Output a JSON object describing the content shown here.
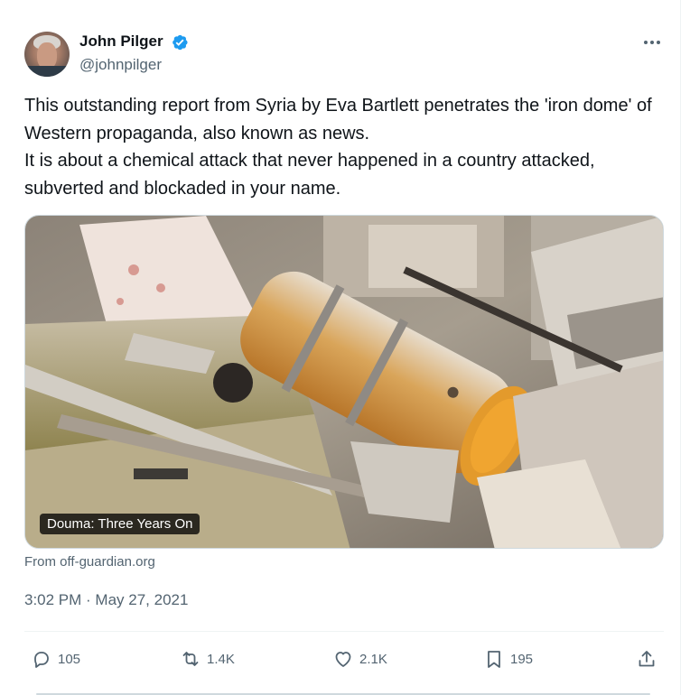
{
  "author": {
    "name": "John Pilger",
    "handle": "@johnpilger",
    "verified_color": "#1d9bf0"
  },
  "tweet": {
    "lines": [
      "This outstanding report from Syria by Eva Bartlett penetrates the 'iron dome' of Western propaganda, also known as news.",
      "It is about a chemical attack that never happened in a country attacked, subverted and blockaded in your name."
    ],
    "timestamp": "3:02 PM · May 27, 2021"
  },
  "media": {
    "label": "Douma: Three Years On",
    "source": "From off-guardian.org"
  },
  "actions": {
    "replies": "105",
    "reposts": "1.4K",
    "likes": "2.1K",
    "bookmarks": "195"
  },
  "icons": {
    "more": "more-icon",
    "reply": "reply-icon",
    "repost": "repost-icon",
    "like": "heart-icon",
    "bookmark": "bookmark-icon",
    "share": "share-icon"
  },
  "colors": {
    "text": "#0f1419",
    "secondary": "#536471",
    "accent": "#1d9bf0"
  }
}
